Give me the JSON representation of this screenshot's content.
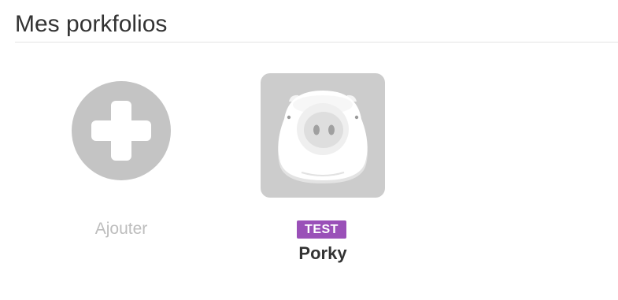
{
  "header": {
    "title": "Mes porkfolios"
  },
  "add_tile": {
    "label": "Ajouter",
    "icon": "plus-circle-icon"
  },
  "portfolios": [
    {
      "name": "Porky",
      "badge": "TEST",
      "avatar_icon": "pig-face-icon"
    }
  ],
  "colors": {
    "badge_background": "#9a50b8",
    "tile_gray": "#cccccc",
    "add_icon_gray": "#c4c4c4"
  }
}
